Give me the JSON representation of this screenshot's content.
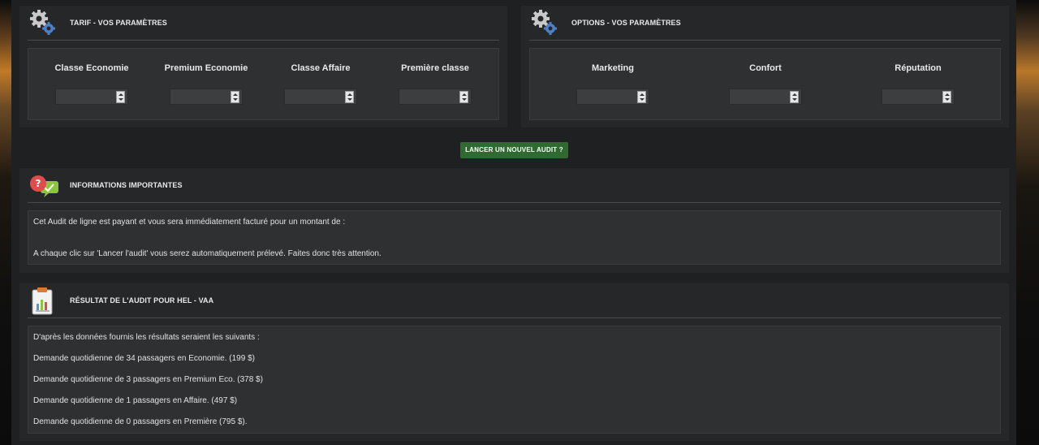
{
  "tarif": {
    "title": "TARIF - VOS PARAMÈTRES",
    "icon": "gears-icon",
    "columns": [
      "Classe Economie",
      "Premium Economie",
      "Classe Affaire",
      "Première classe"
    ],
    "values": [
      "",
      "",
      "",
      ""
    ]
  },
  "options": {
    "title": "OPTIONS - VOS PARAMÈTRES",
    "icon": "gears-icon",
    "columns": [
      "Marketing",
      "Confort",
      "Réputation"
    ],
    "values": [
      "",
      "",
      ""
    ]
  },
  "audit_button": "LANCER UN NOUVEL AUDIT ?",
  "info": {
    "title": "INFORMATIONS IMPORTANTES",
    "icon": "help-chat-icon",
    "line1": "Cet Audit de ligne est payant et vous sera immédiatement facturé pour un montant de :",
    "line2": "A chaque clic sur 'Lancer l'audit' vous serez automatiquement prélevé. Faites donc très attention."
  },
  "result": {
    "title": "RÉSULTAT DE L'AUDIT POUR HEL - VAA",
    "icon": "clipboard-chart-icon",
    "intro": "D'après les données fournis les résultats seraient les suivants :",
    "lines": [
      "Demande quotidienne de 34 passagers en Economie. (199 $)",
      "Demande quotidienne de 3 passagers en Premium Eco. (378 $)",
      "Demande quotidienne de 1 passagers en Affaire. (497 $)",
      "Demande quotidienne de 0 passagers en Première (795 $)."
    ]
  },
  "colors": {
    "button_green": "#2f6b31",
    "panel": "#262729",
    "inner": "#2f3032"
  }
}
